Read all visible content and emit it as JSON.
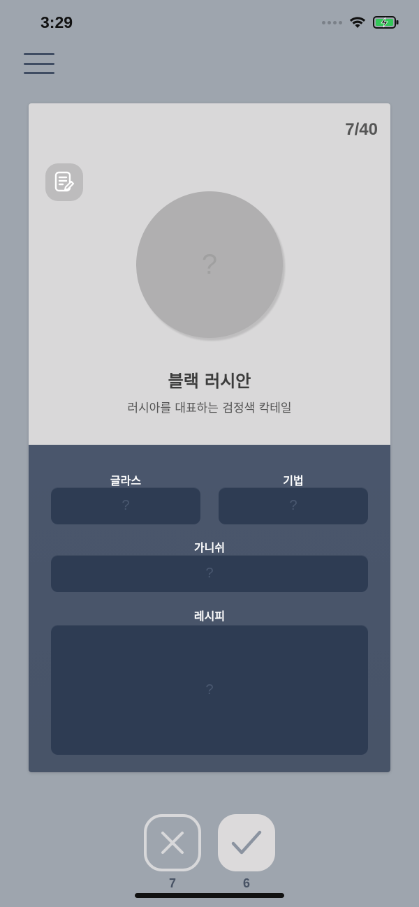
{
  "status_bar": {
    "time": "3:29"
  },
  "card": {
    "progress": "7/40",
    "title": "블랙 러시안",
    "subtitle": "러시아를 대표하는 검정색 칵테일",
    "avatar_placeholder": "?",
    "fields": {
      "glass": {
        "label": "글라스",
        "value": "?"
      },
      "technique": {
        "label": "기법",
        "value": "?"
      },
      "garnish": {
        "label": "가니쉬",
        "value": "?"
      },
      "recipe": {
        "label": "레시피",
        "value": "?"
      }
    }
  },
  "actions": {
    "wrong_count": "7",
    "right_count": "6"
  },
  "colors": {
    "background": "#9ea5ae",
    "card_top": "#d9d8d9",
    "card_bottom": "#4a566c",
    "field": "#2e3c53"
  }
}
